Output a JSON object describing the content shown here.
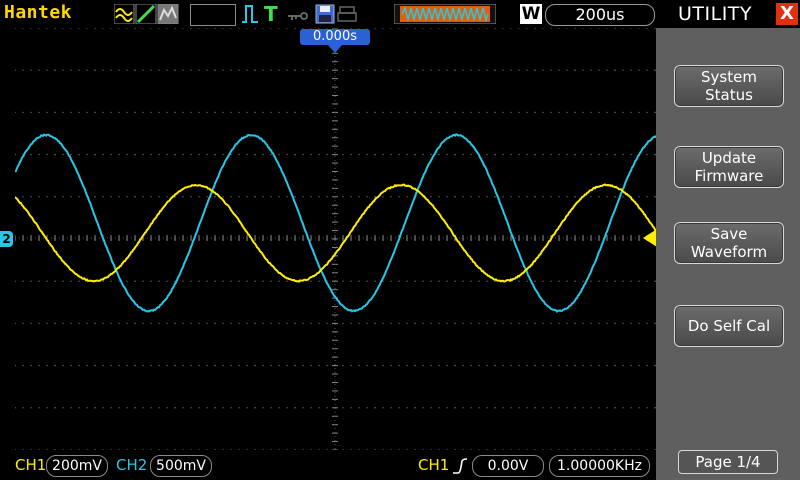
{
  "header": {
    "brand": "Hantek",
    "timebase_mode": "W",
    "timebase": "200us",
    "trigger_position": "0.000s",
    "icons": [
      "wave-icon",
      "ramp-icon",
      "persist-icon",
      "trigger-edge-icon",
      "trigger-t-icon",
      "key-icon",
      "save-disk-icon",
      "print-icon",
      "memory-waveform-icon"
    ]
  },
  "marker": {
    "ch2_label": "2"
  },
  "utility": {
    "title": "UTILITY",
    "close": "X",
    "buttons": [
      {
        "line1": "System",
        "line2": "Status"
      },
      {
        "line1": "Update",
        "line2": "Firmware"
      },
      {
        "line1": "Save",
        "line2": "Waveform"
      },
      {
        "line1": "Do Self Cal",
        "line2": ""
      }
    ],
    "page": "Page 1/4"
  },
  "footer": {
    "ch1_label": "CH1",
    "ch1_scale": "200mV",
    "ch2_label": "CH2",
    "ch2_scale": "500mV",
    "trig_channel": "CH1",
    "trig_level": "0.00V",
    "frequency": "1.00000KHz"
  },
  "colors": {
    "ch1": "#ffee00",
    "ch2": "#25c8e6",
    "brand": "#ffd800",
    "close": "#e03010"
  }
}
